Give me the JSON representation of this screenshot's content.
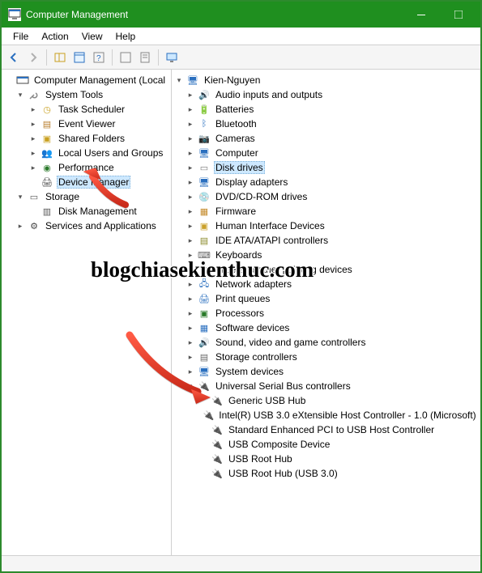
{
  "window": {
    "title": "Computer Management"
  },
  "menu": {
    "file": "File",
    "action": "Action",
    "view": "View",
    "help": "Help"
  },
  "left": {
    "root": "Computer Management (Local",
    "systools": "System Tools",
    "tasksched": "Task Scheduler",
    "eventvwr": "Event Viewer",
    "shared": "Shared Folders",
    "localusers": "Local Users and Groups",
    "perf": "Performance",
    "devmgr": "Device Manager",
    "storage": "Storage",
    "diskmgmt": "Disk Management",
    "services": "Services and Applications"
  },
  "right": {
    "root": "Kien-Nguyen",
    "audio": "Audio inputs and outputs",
    "batteries": "Batteries",
    "bluetooth": "Bluetooth",
    "cameras": "Cameras",
    "computer": "Computer",
    "diskdrives": "Disk drives",
    "display": "Display adapters",
    "dvd": "DVD/CD-ROM drives",
    "firmware": "Firmware",
    "hid": "Human Interface Devices",
    "ide": "IDE ATA/ATAPI controllers",
    "keyboards": "Keyboards",
    "mice": "Mice and other pointing devices",
    "network": "Network adapters",
    "printq": "Print queues",
    "processors": "Processors",
    "software": "Software devices",
    "sound": "Sound, video and game controllers",
    "storagectl": "Storage controllers",
    "sysdev": "System devices",
    "usb": "Universal Serial Bus controllers",
    "usb_children": {
      "generic": "Generic USB Hub",
      "intel": "Intel(R) USB 3.0 eXtensible Host Controller - 1.0 (Microsoft)",
      "standard": "Standard Enhanced PCI to USB Host Controller",
      "composite": "USB Composite Device",
      "roothub": "USB Root Hub",
      "roothub3": "USB Root Hub (USB 3.0)"
    }
  },
  "watermark": "blogchiasekienthuc.com"
}
